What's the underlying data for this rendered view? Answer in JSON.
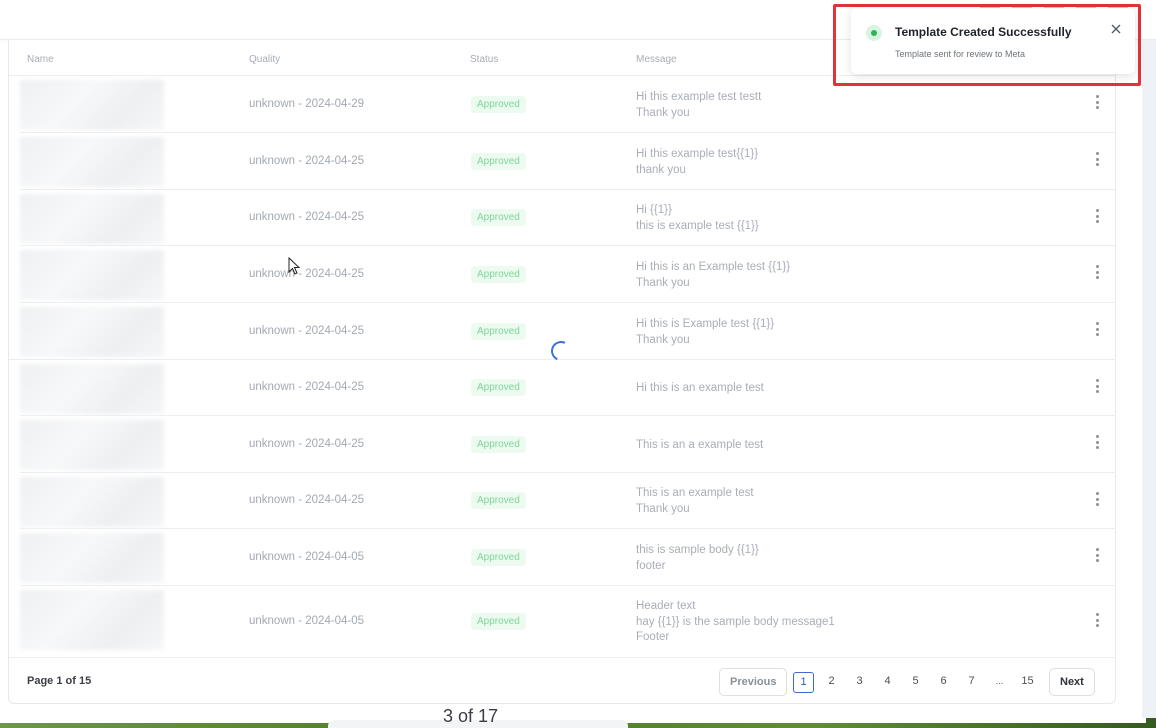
{
  "table": {
    "headers": {
      "name": "Name",
      "quality": "Quality",
      "status": "Status",
      "message": "Message"
    },
    "rows": [
      {
        "quality": "unknown - 2024-04-29",
        "status": "Approved",
        "message": [
          "Hi this example test testt",
          "Thank you"
        ]
      },
      {
        "quality": "unknown - 2024-04-25",
        "status": "Approved",
        "message": [
          "Hi this example test{{1}}",
          "thank you"
        ]
      },
      {
        "quality": "unknown - 2024-04-25",
        "status": "Approved",
        "message": [
          "Hi {{1}}",
          "this is example test {{1}}"
        ]
      },
      {
        "quality": "unknown - 2024-04-25",
        "status": "Approved",
        "message": [
          "Hi this is an Example test {{1}}",
          "Thank you"
        ]
      },
      {
        "quality": "unknown - 2024-04-25",
        "status": "Approved",
        "message": [
          "Hi this is Example test {{1}}",
          "Thank you"
        ]
      },
      {
        "quality": "unknown - 2024-04-25",
        "status": "Approved",
        "message": [
          "Hi this is an example test"
        ]
      },
      {
        "quality": "unknown - 2024-04-25",
        "status": "Approved",
        "message": [
          "This is an a example test"
        ]
      },
      {
        "quality": "unknown - 2024-04-25",
        "status": "Approved",
        "message": [
          "This is an example test",
          "Thank you"
        ]
      },
      {
        "quality": "unknown - 2024-04-05",
        "status": "Approved",
        "message": [
          "this is sample body {{1}}",
          "footer"
        ]
      },
      {
        "quality": "unknown - 2024-04-05",
        "status": "Approved",
        "message": [
          "Header text",
          "hay {{1}} is the sample body message1",
          "Footer"
        ]
      }
    ]
  },
  "pagination": {
    "page_label": "Page 1 of 15",
    "previous_label": "Previous",
    "next_label": "Next",
    "pages": [
      "1",
      "2",
      "3",
      "4",
      "5",
      "6",
      "7",
      "...",
      "15"
    ],
    "current_page": "1"
  },
  "toast": {
    "title": "Template Created Successfully",
    "subtitle": "Template sent for review to Meta",
    "icon": "success-globe-icon",
    "close_icon": "close-icon"
  },
  "viewer": {
    "page_counter": "3 of 17"
  },
  "colors": {
    "approved_bg": "#ecfaf0",
    "approved_text": "#7fd69a",
    "spinner": "#3a6fe0",
    "highlight": "#e0343a",
    "active_page": "#3d6bd1"
  }
}
